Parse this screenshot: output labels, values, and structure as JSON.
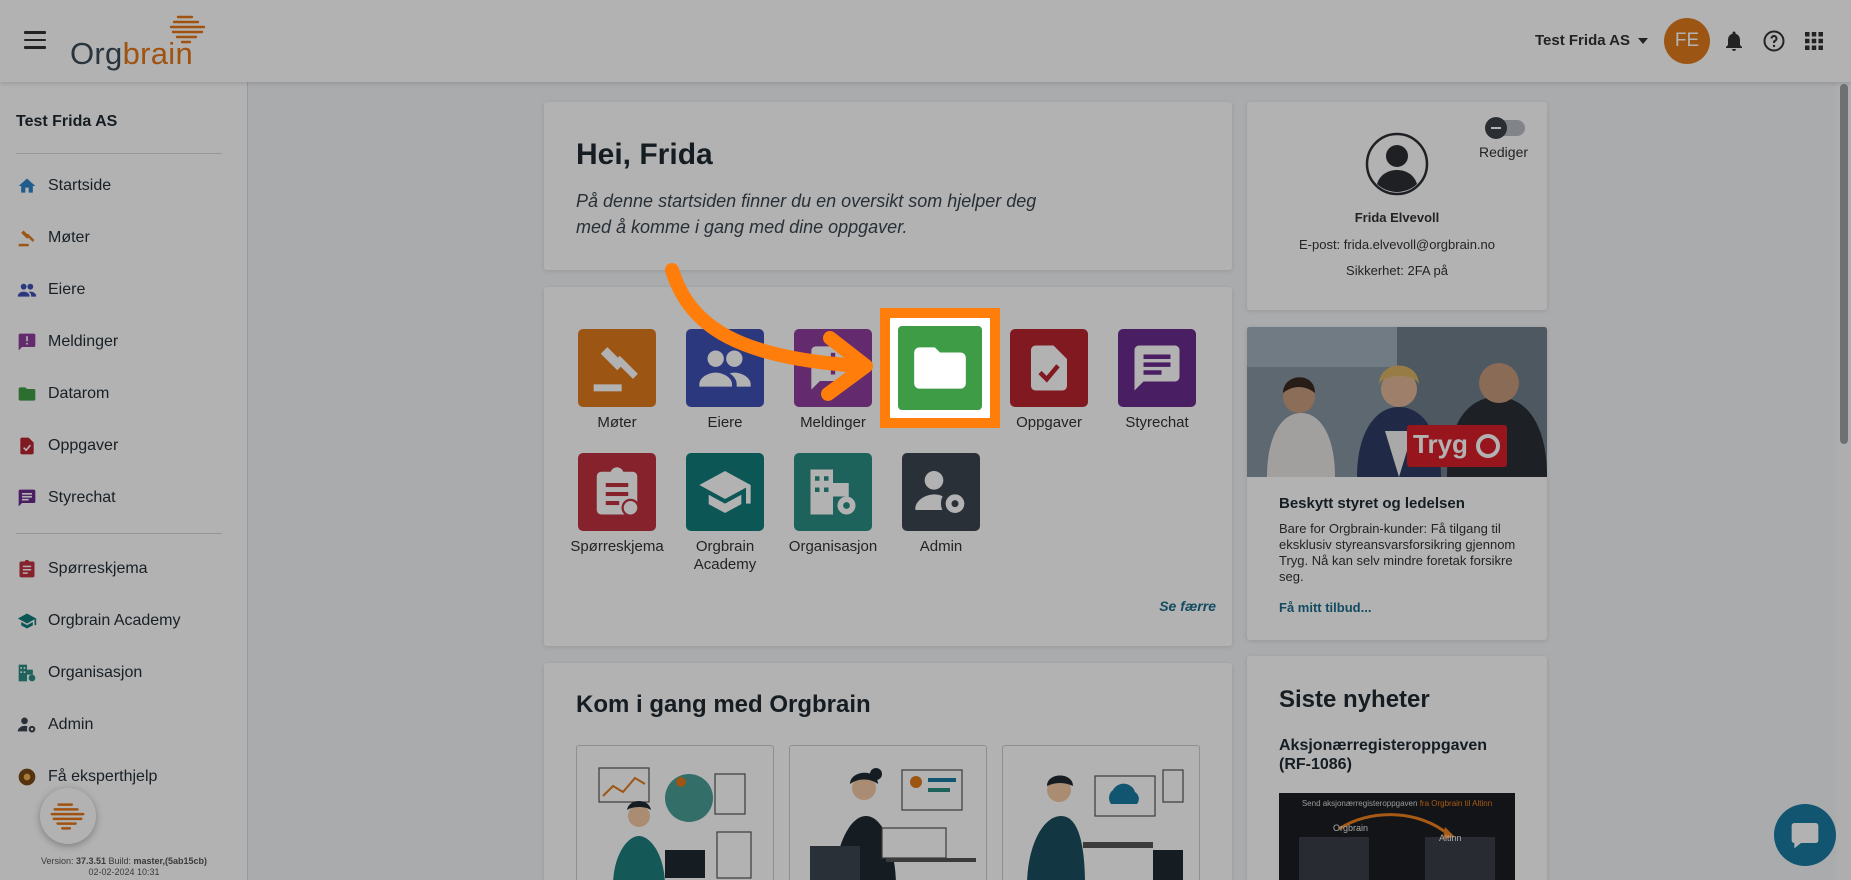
{
  "header": {
    "logo_text_a": "Org",
    "logo_text_b": "brain",
    "company": "Test Frida AS",
    "avatar_initials": "FE",
    "icons": [
      "bell-icon",
      "help-icon",
      "apps-grid-icon"
    ]
  },
  "sidebar": {
    "company": "Test Frida AS",
    "items": [
      {
        "label": "Startside",
        "icon": "home-icon"
      },
      {
        "label": "Møter",
        "icon": "gavel-icon"
      },
      {
        "label": "Eiere",
        "icon": "people-icon"
      },
      {
        "label": "Meldinger",
        "icon": "message-alert-icon"
      },
      {
        "label": "Datarom",
        "icon": "folder-icon"
      },
      {
        "label": "Oppgaver",
        "icon": "task-icon"
      },
      {
        "label": "Styrechat",
        "icon": "chat-icon"
      },
      {
        "label": "Spørreskjema",
        "icon": "clipboard-icon"
      },
      {
        "label": "Orgbrain Academy",
        "icon": "school-icon"
      },
      {
        "label": "Organisasjon",
        "icon": "organization-icon"
      },
      {
        "label": "Admin",
        "icon": "admin-icon"
      },
      {
        "label": "Få eksperthjelp",
        "icon": "expert-icon"
      }
    ],
    "version_line1_prefix": "Version: ",
    "version": "37.3.51",
    "build_prefix": " Build: ",
    "build": "master,(5ab15cb)",
    "date": "02-02-2024 10:31"
  },
  "greeting": {
    "title": "Hei, Frida",
    "text": "På denne startsiden finner du en oversikt som hjelper deg med å komme i gang med dine oppgaver."
  },
  "apps": {
    "tiles": [
      {
        "label": "Møter",
        "color": "#e07a1c"
      },
      {
        "label": "Eiere",
        "color": "#3f51b5"
      },
      {
        "label": "Meldinger",
        "color": "#8e3d9e"
      },
      {
        "label": "Datarom",
        "color": "#3f9c46"
      },
      {
        "label": "Oppgaver",
        "color": "#b9252f"
      },
      {
        "label": "Styrechat",
        "color": "#6a2c8e"
      },
      {
        "label": "Spørreskjema",
        "color": "#c0323e"
      },
      {
        "label": "Orgbrain Academy",
        "color": "#137b7b"
      },
      {
        "label": "Organisasjon",
        "color": "#2a8f83"
      },
      {
        "label": "Admin",
        "color": "#3d4650"
      }
    ],
    "see_less": "Se færre"
  },
  "getting_started": {
    "title": "Kom i gang med Orgbrain"
  },
  "profile": {
    "edit": "Rediger",
    "name": "Frida Elvevoll",
    "email": "E-post: frida.elvevoll@orgbrain.no",
    "security": "Sikkerhet: 2FA på"
  },
  "ad": {
    "brand": "Tryg",
    "title": "Beskytt styret og ledelsen",
    "text": "Bare for Orgbrain-kunder: Få tilgang til eksklusiv styreansvarsforsikring gjennom Tryg. Nå kan selv mindre foretak forsikre seg.",
    "link": "Få mitt tilbud..."
  },
  "news": {
    "title": "Siste nyheter",
    "headline": "Aksjonærregisteroppgaven (RF-1086)",
    "thumb_caption_a": "Send aksjonærregisteroppgaven ",
    "thumb_caption_b": "fra Orgbrain til Altinn",
    "thumb_left": "Orgbrain",
    "thumb_right": "Altinn"
  }
}
